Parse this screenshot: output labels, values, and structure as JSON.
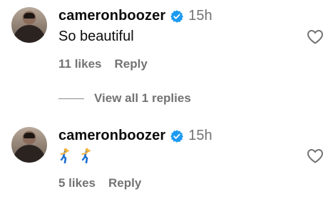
{
  "comments": [
    {
      "username": "cameronboozer",
      "time": "15h",
      "text": "So beautiful",
      "likes": "11 likes",
      "reply": "Reply"
    },
    {
      "username": "cameronboozer",
      "time": "15h",
      "text": "🕺🕺",
      "likes": "5 likes",
      "reply": "Reply"
    }
  ],
  "view_replies": "View all 1 replies",
  "colors": {
    "verified": "#1d9bf0",
    "muted": "#737373"
  },
  "icons": [
    "verified-badge-icon",
    "heart-icon",
    "dancing-man-emoji-icon"
  ]
}
